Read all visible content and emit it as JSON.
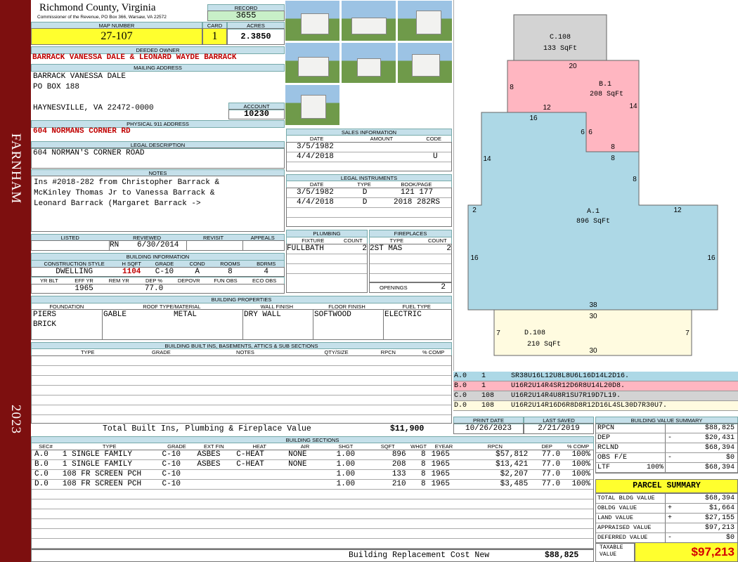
{
  "side": {
    "district": "FARNHAM",
    "year": "2023"
  },
  "header": {
    "county": "Richmond County, Virginia",
    "commissioner": "Commissioner of the Revenue, PO Box 366, Warsaw, VA 22572",
    "record_label": "RECORD",
    "record": "3655",
    "map_number_label": "MAP NUMBER",
    "map_number": "27-107",
    "card_label": "CARD",
    "card": "1",
    "acres_label": "ACRES",
    "acres": "2.3850"
  },
  "owner": {
    "label": "DEEDED OWNER",
    "name": "BARRACK VANESSA DALE & LEONARD WAYDE BARRACK",
    "mailing_label": "MAILING ADDRESS",
    "mailing_line1": "BARRACK VANESSA DALE",
    "mailing_line2": "PO BOX 188",
    "mailing_line3": "HAYNESVILLE, VA 22472-0000",
    "account_label": "ACCOUNT",
    "account": "10230"
  },
  "physical": {
    "label": "PHYSICAL 911 ADDRESS",
    "address": "604 NORMANS CORNER RD"
  },
  "legal": {
    "label": "LEGAL DESCRIPTION",
    "text": "604 NORMAN'S CORNER ROAD"
  },
  "notes": {
    "label": "NOTES",
    "lines": [
      "Ins #2018-282 from Christopher Barrack &",
      "McKinley Thomas Jr to Vanessa Barrack &",
      "Leonard Barrack (Margaret Barrack ->"
    ]
  },
  "listing": {
    "headers": [
      "LISTED",
      "REVIEWED",
      "REVISIT",
      "APPEALS"
    ],
    "reviewed_by": "RN",
    "reviewed_date": "6/30/2014"
  },
  "building_info": {
    "label": "BUILDING INFORMATION",
    "headers": [
      "CONSTRUCTION STYLE",
      "H SQFT",
      "GRADE",
      "COND",
      "ROOMS",
      "BDRMS"
    ],
    "values": [
      "DWELLING",
      "1104",
      "C-10",
      "A",
      "8",
      "4"
    ],
    "headers2": [
      "YR BLT",
      "EFF YR",
      "REM YR",
      "DEP %",
      "DEPOVR",
      "FUN OBS",
      "ECO OBS"
    ],
    "values2": [
      "",
      "1965",
      "",
      "77.0",
      "",
      "",
      ""
    ]
  },
  "sales": {
    "label": "SALES INFORMATION",
    "headers": [
      "DATE",
      "AMOUNT",
      "CODE"
    ],
    "rows": [
      [
        "3/5/1982",
        "",
        ""
      ],
      [
        "4/4/2018",
        "",
        "U"
      ]
    ]
  },
  "legal_instruments": {
    "label": "LEGAL INSTRUMENTS",
    "headers": [
      "DATE",
      "TYPE",
      "BOOK/PAGE"
    ],
    "rows": [
      [
        "3/5/1982",
        "D",
        "121 177"
      ],
      [
        "4/4/2018",
        "D",
        "2018 282RS"
      ]
    ]
  },
  "plumbing": {
    "label": "PLUMBING",
    "headers": [
      "FIXTURE",
      "COUNT"
    ],
    "rows": [
      [
        "FULLBATH",
        "2"
      ]
    ]
  },
  "fireplaces": {
    "label": "FIREPLACES",
    "headers": [
      "TYPE",
      "COUNT"
    ],
    "rows": [
      [
        "2ST MAS",
        "2"
      ]
    ],
    "openings_label": "OPENINGS",
    "openings": "2"
  },
  "building_properties": {
    "label": "BUILDING PROPERTIES",
    "headers": [
      "FOUNDATION",
      "ROOF TYPE/MATERIAL",
      "WALL FINISH",
      "FLOOR FINISH",
      "FUEL TYPE"
    ],
    "foundation": [
      "PIERS",
      "BRICK"
    ],
    "roof_type": "GABLE",
    "roof_material": "METAL",
    "wall": "DRY WALL",
    "floor": "SOFTWOOD",
    "fuel": "ELECTRIC"
  },
  "builtins": {
    "label": "BUILDING BUILT INS, BASEMENTS, ATTICS & SUB SECTIONS",
    "headers": [
      "TYPE",
      "GRADE",
      "NOTES",
      "QTY/SIZE",
      "RPCN",
      "% COMP"
    ],
    "total_label": "Total Built Ins, Plumbing & Fireplace Value",
    "total": "$11,900"
  },
  "sketch": {
    "sections": [
      {
        "id": "C.108",
        "area": "133 SqFt"
      },
      {
        "id": "B.1",
        "area": "208 SqFt"
      },
      {
        "id": "A.1",
        "area": "896 SqFt"
      },
      {
        "id": "D.108",
        "area": "210 SqFt"
      }
    ],
    "dims": [
      "20",
      "8",
      "14",
      "12",
      "16",
      "6",
      "6",
      "8",
      "8",
      "14",
      "8",
      "2",
      "12",
      "16",
      "16",
      "38",
      "30",
      "7",
      "7",
      "30"
    ],
    "colors": {
      "A": "#add8e6",
      "B": "#ffb6c1",
      "C": "#d3d3d3",
      "D": "#fffbe0"
    }
  },
  "vectors": [
    {
      "sec": "A.0",
      "n": "1",
      "code": "SR38U16L12U8L8U6L16D14L2D16."
    },
    {
      "sec": "B.0",
      "n": "1",
      "code": "U16R2U14R4SR12D6R8U14L20D8."
    },
    {
      "sec": "C.0",
      "n": "108",
      "code": "U16R2U14R4U8R1SU7R19D7L19."
    },
    {
      "sec": "D.0",
      "n": "108",
      "code": "U16R2U14R16D6R8D8R12D16L4SL30D7R30U7."
    }
  ],
  "print": {
    "print_label": "PRINT DATE",
    "print_date": "10/26/2023",
    "saved_label": "LAST SAVED",
    "saved_date": "2/21/2019"
  },
  "sections": {
    "label": "BUILDING SECTIONS",
    "headers": [
      "SEC#",
      "TYPE",
      "GRADE",
      "EXT FIN",
      "HEAT",
      "AIR",
      "SHGT",
      "SQFT",
      "WHGT",
      "EYEAR",
      "RPCN",
      "DEP",
      "% COMP"
    ],
    "rows": [
      [
        "A.0",
        "1 SINGLE FAMILY",
        "C-10",
        "ASBES",
        "C-HEAT",
        "NONE",
        "1.00",
        "896",
        "8",
        "1965",
        "$57,812",
        "77.0",
        "100%"
      ],
      [
        "B.0",
        "1 SINGLE FAMILY",
        "C-10",
        "ASBES",
        "C-HEAT",
        "NONE",
        "1.00",
        "208",
        "8",
        "1965",
        "$13,421",
        "77.0",
        "100%"
      ],
      [
        "C.0",
        "108 FR SCREEN PCH",
        "C-10",
        "",
        "",
        "",
        "1.00",
        "133",
        "8",
        "1965",
        "$2,207",
        "77.0",
        "100%"
      ],
      [
        "D.0",
        "108 FR SCREEN PCH",
        "C-10",
        "",
        "",
        "",
        "1.00",
        "210",
        "8",
        "1965",
        "$3,485",
        "77.0",
        "100%"
      ]
    ],
    "rcn_label": "Building Replacement Cost New",
    "rcn": "$88,825"
  },
  "value_summary": {
    "label": "BUILDING VALUE SUMMARY",
    "rows": [
      {
        "k": "RPCN",
        "s": "",
        "v": "$88,825"
      },
      {
        "k": "DEP",
        "s": "-",
        "v": "$20,431"
      },
      {
        "k": "RCLND",
        "s": "",
        "v": "$68,394"
      },
      {
        "k": "OBS F/E",
        "s": "-",
        "v": "$0"
      },
      {
        "k": "LTF",
        "p": "100%",
        "s": "",
        "v": "$68,394"
      }
    ]
  },
  "parcel": {
    "label": "PARCEL SUMMARY",
    "rows": [
      {
        "k": "TOTAL BLDG VALUE",
        "s": "",
        "v": "$68,394"
      },
      {
        "k": "OBLDG VALUE",
        "s": "+",
        "v": "$1,664"
      },
      {
        "k": "LAND VALUE",
        "s": "+",
        "v": "$27,155"
      },
      {
        "k": "APPRAISED VALUE",
        "s": "",
        "v": "$97,213"
      },
      {
        "k": "DEFERRED VALUE",
        "s": "-",
        "v": "$0"
      }
    ],
    "taxable_label1": "TAXABLE",
    "taxable_label2": "VALUE",
    "taxable": "$97,213"
  }
}
